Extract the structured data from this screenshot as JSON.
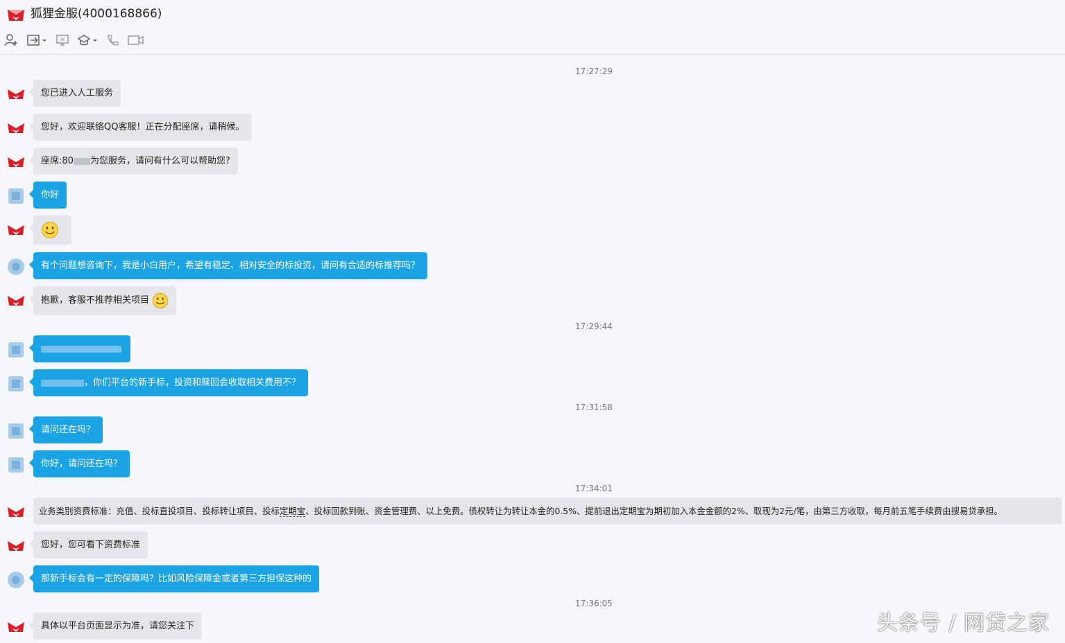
{
  "window": {
    "title": "狐狸金服(4000168866)"
  },
  "toolbar": {
    "icons": [
      "add-contact-icon",
      "transfer-icon",
      "screen-share-icon",
      "service-rating-icon",
      "phone-icon",
      "video-icon"
    ]
  },
  "chat": {
    "timestamps": [
      "17:27:29",
      "17:29:44",
      "17:31:58",
      "17:34:01",
      "17:36:05"
    ],
    "messages": [
      {
        "from": "agent",
        "text": "您已进入人工服务"
      },
      {
        "from": "agent",
        "text": "您好，欢迎联络QQ客服！正在分配座席，请稍候。"
      },
      {
        "from": "agent",
        "text_prefix": "座席:80",
        "text_suffix": "为您服务，请问有什么可以帮助您?"
      },
      {
        "from": "user",
        "text": "你好"
      },
      {
        "from": "agent",
        "emoji": "smiley"
      },
      {
        "from": "user",
        "text": "有个问题想咨询下，我是小白用户，希望有稳定、相对安全的标投资，请问有合适的标推荐吗？"
      },
      {
        "from": "agent",
        "text": "抱歉，客服不推荐相关项目",
        "emoji": "smiley"
      },
      {
        "from": "user",
        "redacted": true
      },
      {
        "from": "user",
        "text": "，你们平台的新手标，投资和赎回会收取相关费用不？",
        "redacted_prefix": true
      },
      {
        "from": "user",
        "text": "请问还在吗？"
      },
      {
        "from": "user",
        "text": "你好，请问还在吗？"
      },
      {
        "from": "agent",
        "text_a": "业务类别资费标准：充值、投标直投项目、投标转让项目、投标",
        "text_b": "定期宝",
        "text_c": "、投标回款到账、资金管理费、以上免费。债权转让为转让本金的0.5%、提前退出定期宝为期初加入本金金额的2%、取现为2元/笔，由第三方收取，每月前五笔手续费由搜易贷承担。"
      },
      {
        "from": "agent",
        "text": "您好，您可看下资费标准"
      },
      {
        "from": "user",
        "text": "那新手标会有一定的保障吗？比如风险保障金或者第三方担保这种的"
      },
      {
        "from": "agent",
        "text": "具体以平台页面显示为准，请您关注下"
      }
    ]
  },
  "watermark": {
    "text": "头条号 / 网贷之家"
  },
  "colors": {
    "agent_bubble": "#e5e6e9",
    "user_bubble": "#1aa3e5",
    "background": "#f5f7fb",
    "brand_red": "#d9202a"
  }
}
